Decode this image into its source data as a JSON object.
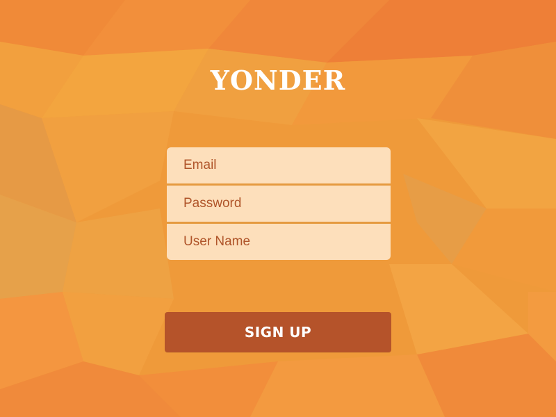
{
  "app": {
    "logo": "YONDER"
  },
  "form": {
    "email_placeholder": "Email",
    "password_placeholder": "Password",
    "username_placeholder": "User Name"
  },
  "actions": {
    "signup_label": "SIGN UP"
  },
  "colors": {
    "background": "#ef9a3a",
    "field_text": "#b0552a",
    "field_background": "#ffe8cd",
    "button": "#b5532a",
    "logo": "#ffffff"
  }
}
